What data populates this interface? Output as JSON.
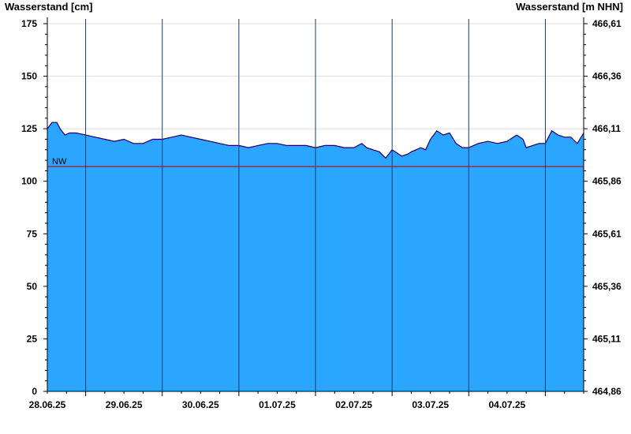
{
  "chart_data": {
    "type": "area",
    "ylabel_left": "Wasserstand [cm]",
    "ylabel_right": "Wasserstand [m NHN]",
    "ylim": [
      0,
      175
    ],
    "y_ticks_left": [
      0,
      25,
      50,
      75,
      100,
      125,
      150,
      175
    ],
    "y_ticks_right": [
      "464,86",
      "465,11",
      "465,36",
      "465,61",
      "465,86",
      "466,11",
      "466,36",
      "466,61"
    ],
    "x_start": "2025-06-27T12:00",
    "x_end": "2025-07-04T12:00",
    "x_ticks": [
      "28.06.25",
      "29.06.25",
      "30.06.25",
      "01.07.25",
      "02.07.25",
      "03.07.25",
      "04.07.25"
    ],
    "reference_line": {
      "label": "NW",
      "value": 107,
      "color": "#cc0000"
    },
    "fill_color": "#2aa6ff",
    "line_color": "#00008b",
    "series": [
      {
        "x": [
          "2025-06-27T12:00",
          "2025-06-27T13:30",
          "2025-06-27T15:00",
          "2025-06-27T16:00",
          "2025-06-27T17:30",
          "2025-06-27T19:00",
          "2025-06-27T21:00",
          "2025-06-28T00:00",
          "2025-06-28T03:00",
          "2025-06-28T06:00",
          "2025-06-28T09:00",
          "2025-06-28T12:00",
          "2025-06-28T15:00",
          "2025-06-28T18:00",
          "2025-06-28T21:00",
          "2025-06-29T00:00",
          "2025-06-29T03:00",
          "2025-06-29T06:00",
          "2025-06-29T09:00",
          "2025-06-29T12:00",
          "2025-06-29T15:00",
          "2025-06-29T18:00",
          "2025-06-29T21:00",
          "2025-06-30T00:00",
          "2025-06-30T03:00",
          "2025-06-30T06:00",
          "2025-06-30T09:00",
          "2025-06-30T12:00",
          "2025-06-30T15:00",
          "2025-06-30T18:00",
          "2025-06-30T21:00",
          "2025-07-01T00:00",
          "2025-07-01T03:00",
          "2025-07-01T06:00",
          "2025-07-01T09:00",
          "2025-07-01T12:00",
          "2025-07-01T14:30",
          "2025-07-01T16:00",
          "2025-07-01T18:00",
          "2025-07-01T20:00",
          "2025-07-01T22:00",
          "2025-07-02T00:00",
          "2025-07-02T03:00",
          "2025-07-02T05:00",
          "2025-07-02T06:00",
          "2025-07-02T07:30",
          "2025-07-02T09:00",
          "2025-07-02T10:30",
          "2025-07-02T12:00",
          "2025-07-02T14:00",
          "2025-07-02T16:00",
          "2025-07-02T18:00",
          "2025-07-02T20:00",
          "2025-07-02T22:00",
          "2025-07-03T00:00",
          "2025-07-03T03:00",
          "2025-07-03T06:00",
          "2025-07-03T09:00",
          "2025-07-03T12:00",
          "2025-07-03T15:00",
          "2025-07-03T17:00",
          "2025-07-03T18:00",
          "2025-07-03T20:00",
          "2025-07-03T22:00",
          "2025-07-04T00:00",
          "2025-07-04T02:00",
          "2025-07-04T04:00",
          "2025-07-04T06:00",
          "2025-07-04T08:00",
          "2025-07-04T10:00",
          "2025-07-04T12:00"
        ],
        "y": [
          125,
          128,
          128,
          125,
          122,
          123,
          123,
          122,
          121,
          120,
          119,
          120,
          118,
          118,
          120,
          120,
          121,
          122,
          121,
          120,
          119,
          118,
          117,
          117,
          116,
          117,
          118,
          118,
          117,
          117,
          117,
          116,
          117,
          117,
          116,
          116,
          118,
          116,
          115,
          114,
          111,
          115,
          112,
          113,
          114,
          115,
          116,
          115,
          120,
          124,
          122,
          123,
          118,
          116,
          116,
          118,
          119,
          118,
          119,
          122,
          120,
          116,
          117,
          118,
          118,
          124,
          122,
          121,
          121,
          118,
          123
        ]
      }
    ]
  }
}
